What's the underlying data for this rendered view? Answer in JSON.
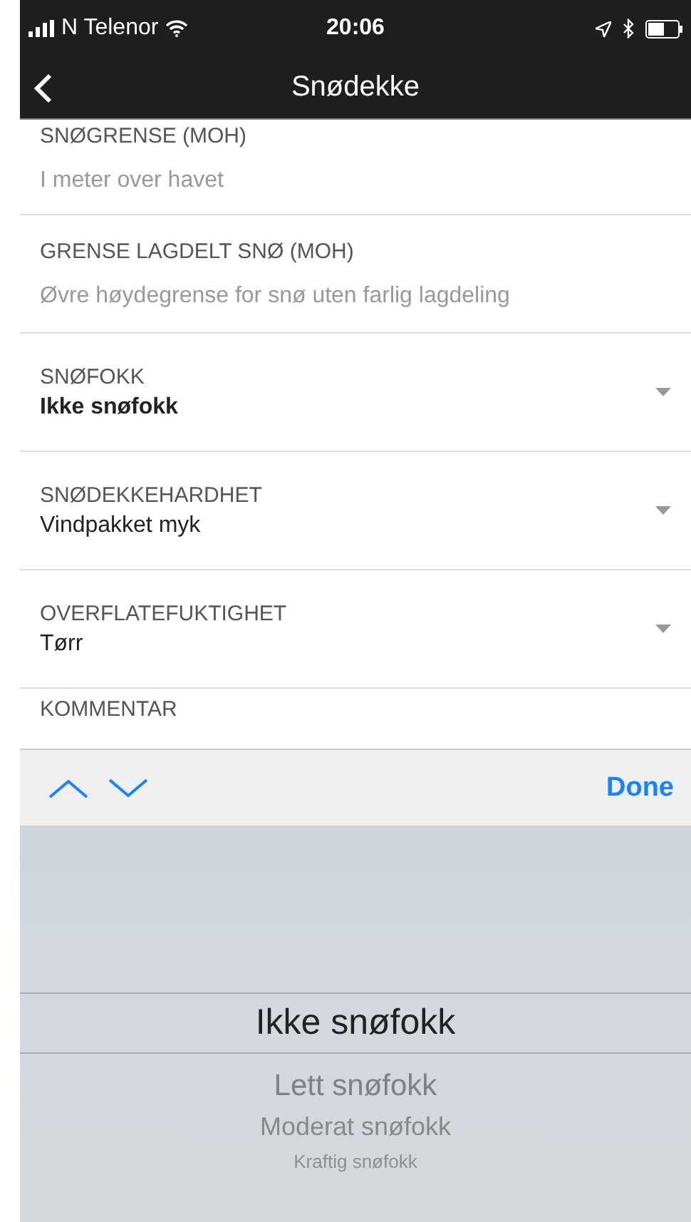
{
  "status_bar": {
    "carrier": "N Telenor",
    "time": "20:06"
  },
  "nav_bar": {
    "title": "Snødekke"
  },
  "fields": [
    {
      "kind": "text",
      "label": "SNØGRENSE (MOH)",
      "placeholder": "I meter over havet"
    },
    {
      "kind": "text",
      "label": "GRENSE LAGDELT SNØ (MOH)",
      "placeholder": "Øvre høydegrense for snø uten farlig lagdeling"
    },
    {
      "kind": "select",
      "label": "SNØFOKK",
      "value": "Ikke snøfokk",
      "active": true
    },
    {
      "kind": "select",
      "label": "SNØDEKKEHARDHET",
      "value": "Vindpakket myk",
      "active": false
    },
    {
      "kind": "select",
      "label": "OVERFLATEFUKTIGHET",
      "value": "Tørr",
      "active": false
    },
    {
      "kind": "text",
      "label": "KOMMENTAR"
    }
  ],
  "keyboard_toolbar": {
    "done": "Done"
  },
  "picker": {
    "options": [
      {
        "label": "Ikke snøfokk",
        "selected": true
      },
      {
        "label": "Lett snøfokk",
        "selected": false
      },
      {
        "label": "Moderat snøfokk",
        "selected": false
      },
      {
        "label": "Kraftig snøfokk",
        "selected": false
      }
    ]
  }
}
